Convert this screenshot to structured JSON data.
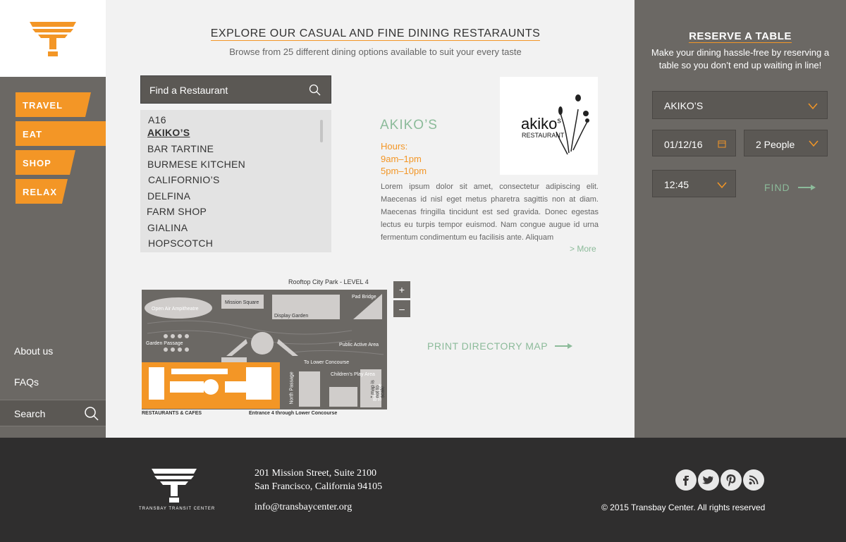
{
  "sidebar": {
    "nav": [
      "TRAVEL",
      "EAT",
      "SHOP",
      "RELAX"
    ],
    "links": {
      "about": "About us",
      "faqs": "FAQs"
    },
    "search_label": "Search"
  },
  "main": {
    "title": "EXPLORE OUR CASUAL AND FINE DINING RESTARAUNTS",
    "subtitle": "Browse from 25 different dining options available to suit your every taste",
    "find_label": "Find a Restaurant",
    "list": [
      "A16",
      "AKIKO’S",
      "BAR TARTINE",
      "BURMESE KITCHEN",
      "CALIFORNIO’S",
      "DELFINA",
      "FARM SHOP",
      "GIALINA",
      "HOPSCOTCH"
    ],
    "selected_index": 1,
    "restaurant": {
      "name": "AKIKO’S",
      "hours_label": "Hours:",
      "hours": [
        "9am–1pm",
        "5pm–10pm"
      ],
      "logo_text": "akiko",
      "logo_superscript": "s",
      "logo_sub": "RESTAURANT",
      "description": "Lorem ipsum dolor sit amet, consectetur adipiscing elit. Maecenas id nisl eget metus pharetra sagittis non at diam. Maecenas fringilla tincidunt est sed gravida. Donec egestas lectus eu turpis tempor euismod. Nam congue augue id urna fermentum condimentum eu facilisis ante. Aliquam",
      "more": "> More"
    },
    "map": {
      "title": "Rooftop City Park - LEVEL 4",
      "labels": {
        "amphitheatre": "Open Air Ampitheatre",
        "mission_square": "Mission Square",
        "display_garden": "Display Garden",
        "pad_bridge": "Pad Bridge",
        "garden_passage": "Garden Passage",
        "public_active": "Public Active Area",
        "lower_concourse": "To Lower Concourse",
        "north_passage": "North Passage",
        "childrens_play": "Children’s Play Area",
        "bike_storage": "Bike Storage",
        "restaurants": "RESTAURANTS & CAFES",
        "entrance": "Entrance 4 through Lower Concourse",
        "scale_note": "* map is not to scale"
      },
      "zoom_in": "+",
      "zoom_out": "–"
    },
    "print_link": "PRINT DIRECTORY MAP"
  },
  "reserve": {
    "title": "RESERVE A TABLE",
    "description": "Make your dining hassle-free by reserving a table so you don’t end up waiting in line!",
    "restaurant": "AKIKO’S",
    "date": "01/12/16",
    "party": "2 People",
    "time": "12:45",
    "find": "FIND"
  },
  "footer": {
    "logo_text": "TRANSBAY TRANSIT CENTER",
    "address1": "201 Mission Street, Suite 2100",
    "address2": "San Francisco, California 94105",
    "email": "info@transbaycenter.org",
    "copyright": "© 2015 Transbay Center. All rights reserved"
  },
  "colors": {
    "accent": "#f39626",
    "green": "#8cbb9a",
    "panel": "#6b6864",
    "footer": "#2f2e2e"
  },
  "icons": [
    "logo-icon",
    "search-icon",
    "calendar-icon",
    "chevron-down-icon",
    "arrow-right-icon",
    "facebook-icon",
    "twitter-icon",
    "pinterest-icon",
    "rss-icon"
  ]
}
